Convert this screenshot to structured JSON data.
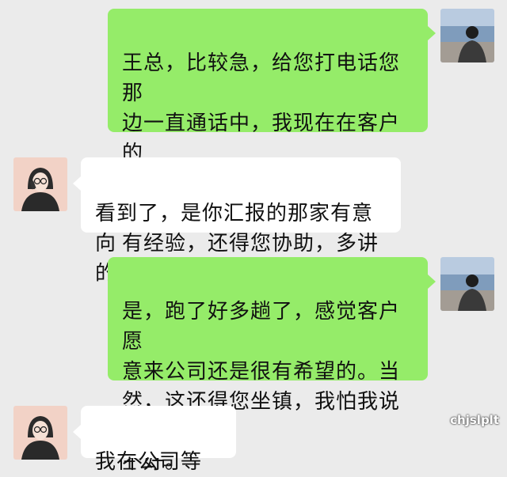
{
  "chat": {
    "messages": [
      {
        "sender": "me",
        "avatar": "boy-by-sea-avatar",
        "text": "王总，比较急，给您打电话您那\n边一直通话中，我现在在客户的\n车上，带着客户给公司去。我没\n有经验，还得您协助，多讲下。"
      },
      {
        "sender": "boss",
        "avatar": "cartoon-woman-on-phone-avatar",
        "text": "看到了，是你汇报的那家有意向\n的客户？"
      },
      {
        "sender": "me",
        "avatar": "boy-by-sea-avatar",
        "text": "是，跑了好多趟了，感觉客户愿\n意来公司还是很有希望的。当\n然，这还得您坐镇，我怕我说的\n不好。"
      },
      {
        "sender": "boss",
        "avatar": "cartoon-woman-on-phone-avatar",
        "text": "我在公司等"
      }
    ]
  },
  "watermark": {
    "text": "chjslplt"
  },
  "colors": {
    "background": "#ebebeb",
    "sent_bubble": "#95ec69",
    "received_bubble": "#ffffff"
  }
}
